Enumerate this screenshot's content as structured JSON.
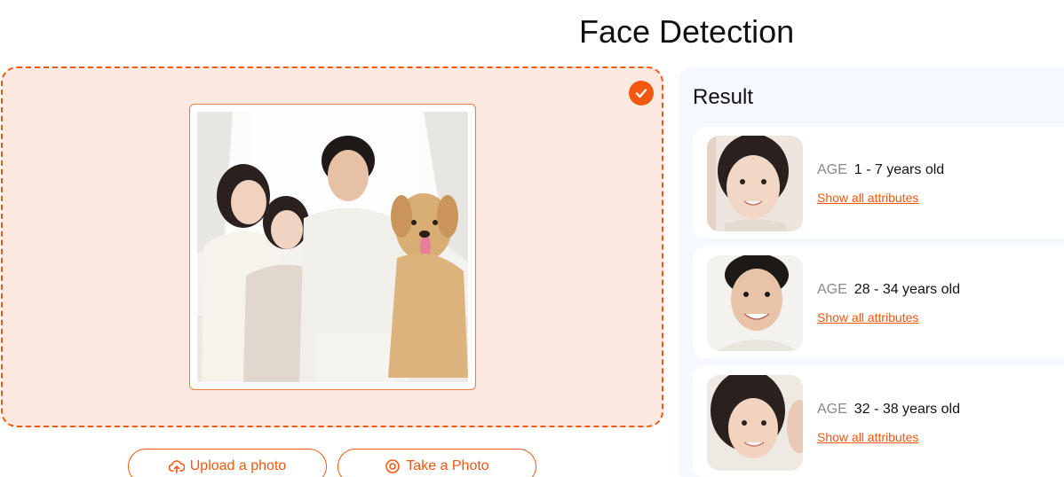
{
  "page": {
    "title": "Face Detection"
  },
  "upload": {
    "status_icon": "check-circle-icon",
    "photo_alt": "Family photo with mother, daughter, father and golden retriever"
  },
  "actions": {
    "upload_label": "Upload a photo",
    "upload_icon": "cloud-upload-icon",
    "take_label": "Take a Photo",
    "take_icon": "camera-icon"
  },
  "result": {
    "heading": "Result",
    "items": [
      {
        "age_label": "AGE",
        "age_value": "1 - 7 years old",
        "link": "Show all attributes"
      },
      {
        "age_label": "AGE",
        "age_value": "28 - 34 years old",
        "link": "Show all attributes"
      },
      {
        "age_label": "AGE",
        "age_value": "32 - 38 years old",
        "link": "Show all attributes"
      }
    ]
  },
  "colors": {
    "accent": "#f2570f",
    "dropzone_bg": "#fee9e1",
    "panel_bg": "#f5f8ff"
  }
}
